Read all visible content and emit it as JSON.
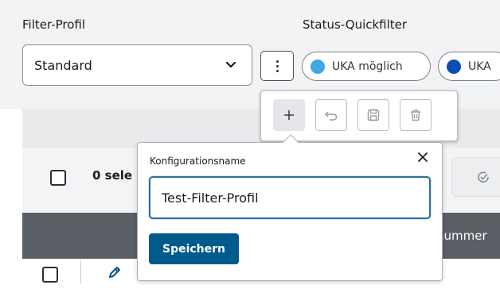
{
  "filter_profile": {
    "label": "Filter-Profil",
    "selected": "Standard",
    "chevron_icon": "chevron-down-icon"
  },
  "status_quickfilter": {
    "label": "Status-Quickfilter",
    "chips": [
      {
        "label": "UKA möglich",
        "dot_color": "#3fa8e6"
      },
      {
        "label": "UKA",
        "dot_color": "#0b4fb3"
      }
    ]
  },
  "more_menu_icon": "kebab-menu-icon",
  "action_popup": {
    "buttons": [
      {
        "icon": "plus-icon",
        "state": "active"
      },
      {
        "icon": "undo-icon",
        "state": "default"
      },
      {
        "icon": "save-icon",
        "state": "default"
      },
      {
        "icon": "trash-icon",
        "state": "default"
      }
    ]
  },
  "config_popup": {
    "label": "Konfigurationsname",
    "input_value": "Test-Filter-Profil",
    "save_label": "Speichern",
    "close_icon": "close-icon"
  },
  "table": {
    "selected_text": "0 sele",
    "header_partial": "nummer",
    "row_edit_icon": "pencil-icon"
  },
  "colors": {
    "primary": "#005b8c",
    "header_bg": "#5b5f66",
    "focus_border": "#2f6f97"
  }
}
